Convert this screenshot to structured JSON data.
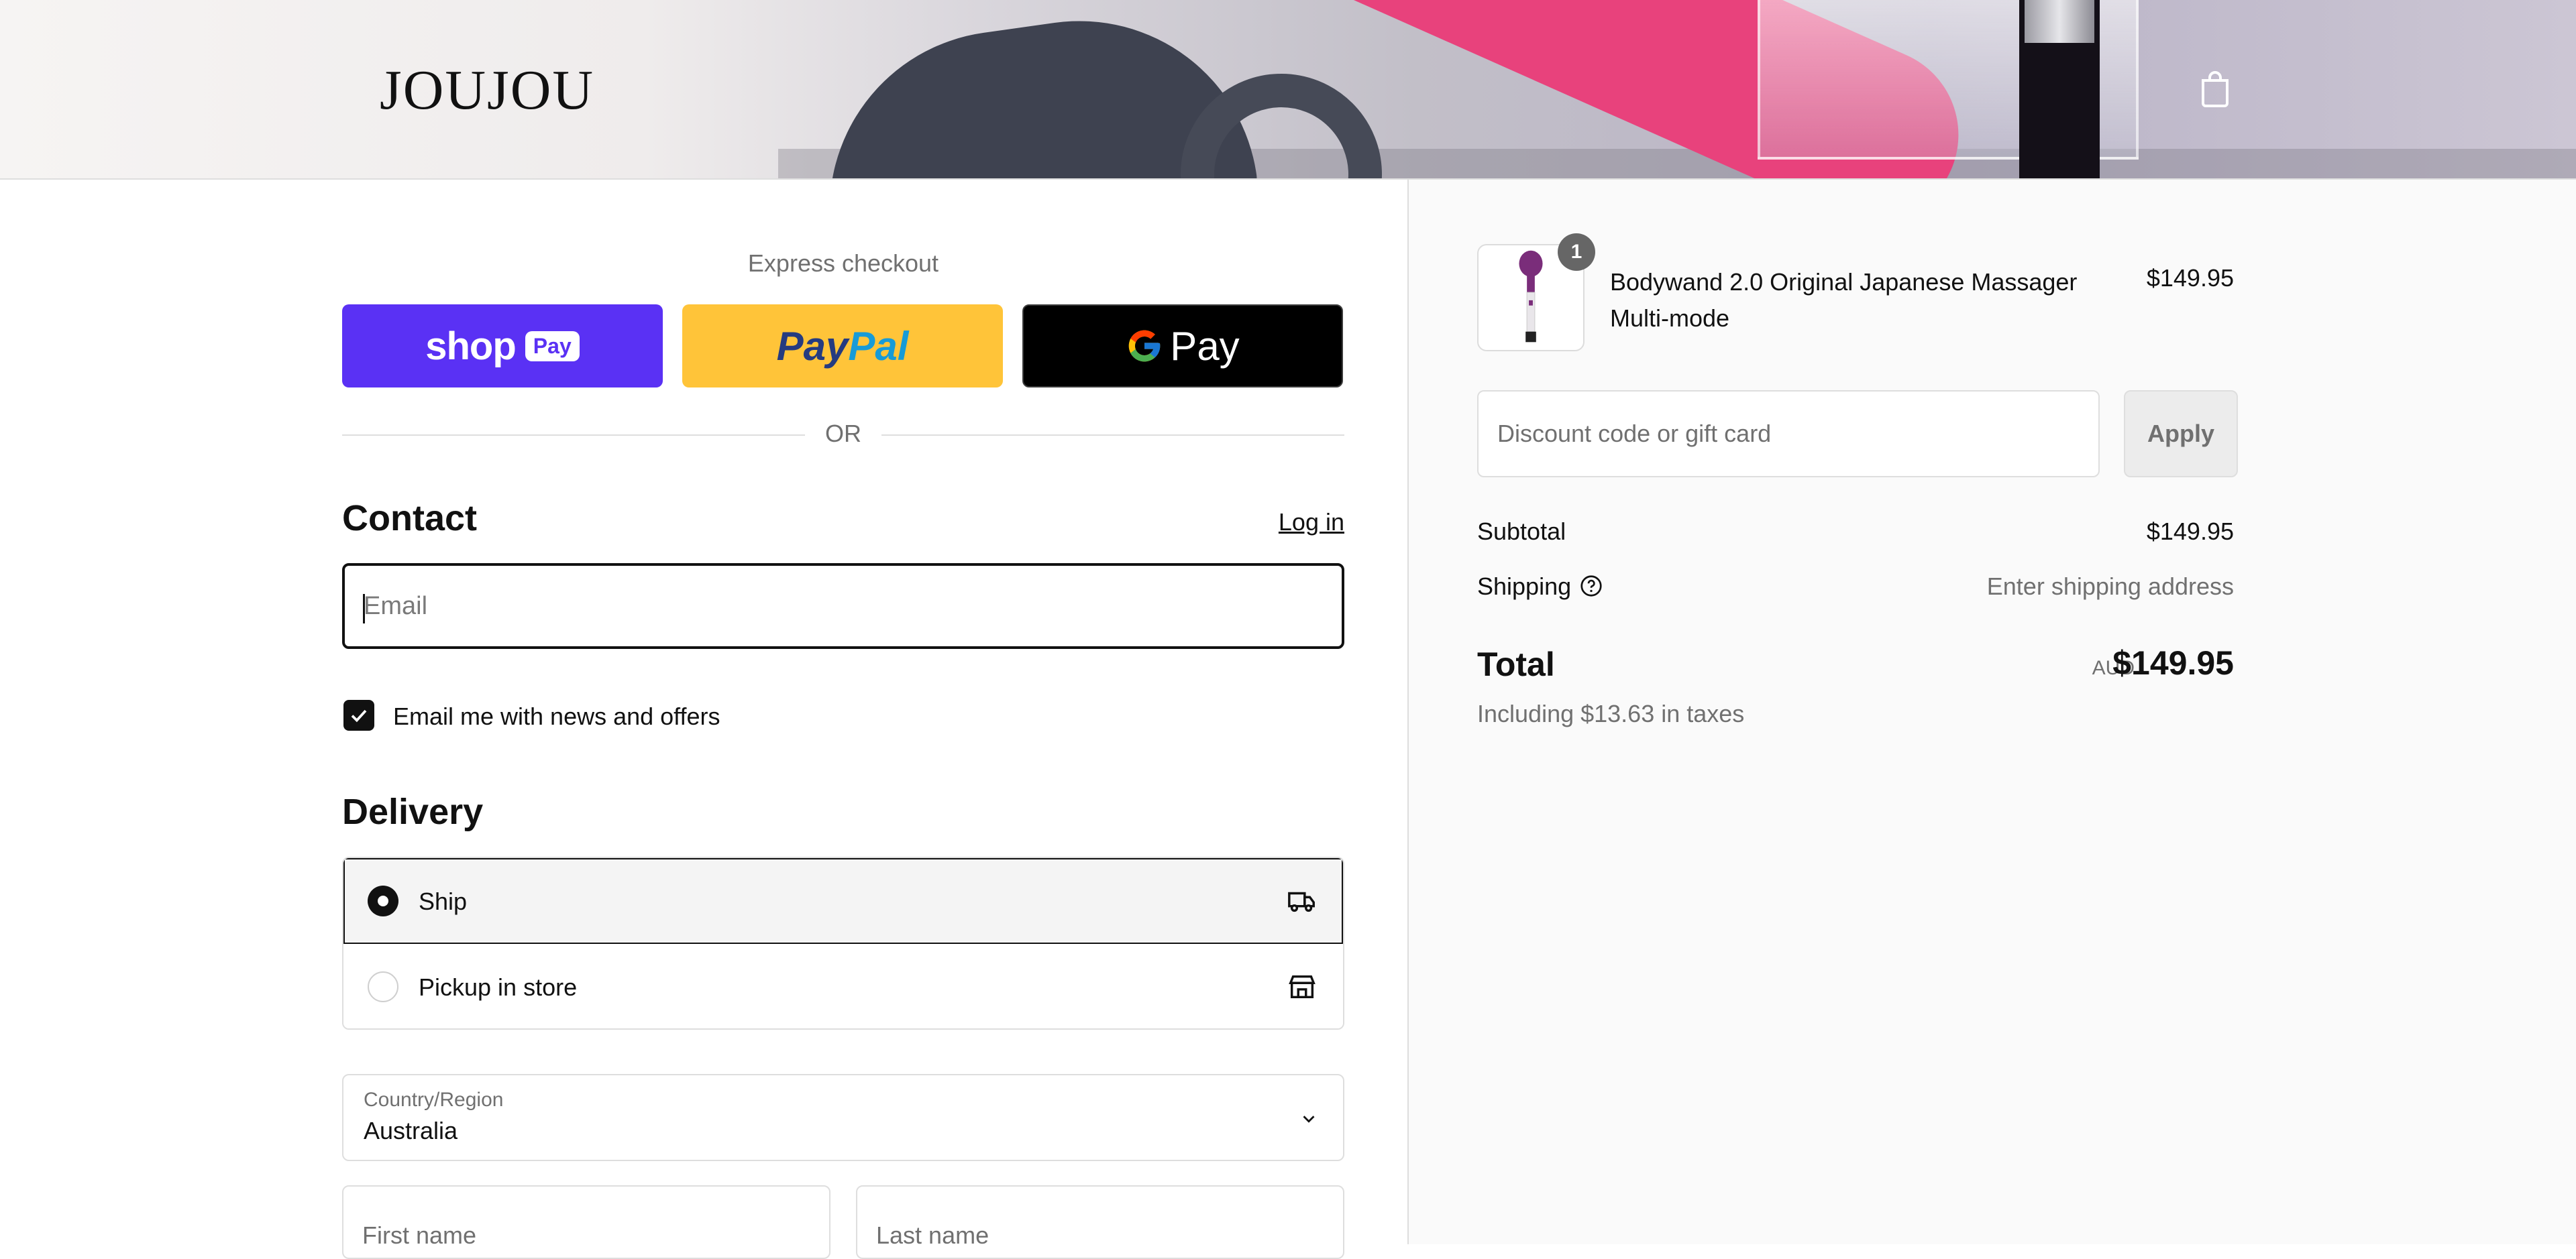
{
  "header": {
    "logo": "JOUJOU",
    "cart_icon": "shopping-bag-icon"
  },
  "express": {
    "title": "Express checkout",
    "shop_pay": {
      "word": "shop",
      "pill": "Pay",
      "color": "#5a31f4"
    },
    "paypal": {
      "part1": "Pay",
      "part2": "Pal",
      "color": "#ffc439"
    },
    "gpay": {
      "label": "Pay",
      "color": "#000000"
    },
    "or_text": "OR"
  },
  "contact": {
    "title": "Contact",
    "login_link": "Log in",
    "email_placeholder": "Email",
    "email_value": "",
    "newsletter_label": "Email me with news and offers",
    "newsletter_checked": true
  },
  "delivery": {
    "title": "Delivery",
    "options": [
      {
        "label": "Ship",
        "selected": true,
        "icon": "truck-icon"
      },
      {
        "label": "Pickup in store",
        "selected": false,
        "icon": "store-icon"
      }
    ],
    "country": {
      "caption": "Country/Region",
      "value": "Australia"
    },
    "first_name_placeholder": "First name",
    "last_name_placeholder": "Last name"
  },
  "summary": {
    "item": {
      "name": "Bodywand 2.0 Original Japanese Massager Multi-mode",
      "price": "$149.95",
      "quantity": "1",
      "thumb_color": "#7a2d7a"
    },
    "discount_placeholder": "Discount code or gift card",
    "apply_label": "Apply",
    "subtotal_label": "Subtotal",
    "subtotal_value": "$149.95",
    "shipping_label": "Shipping",
    "shipping_value": "Enter shipping address",
    "total_label": "Total",
    "currency": "AUD",
    "total_value": "$149.95",
    "taxes_note": "Including $13.63 in taxes"
  }
}
